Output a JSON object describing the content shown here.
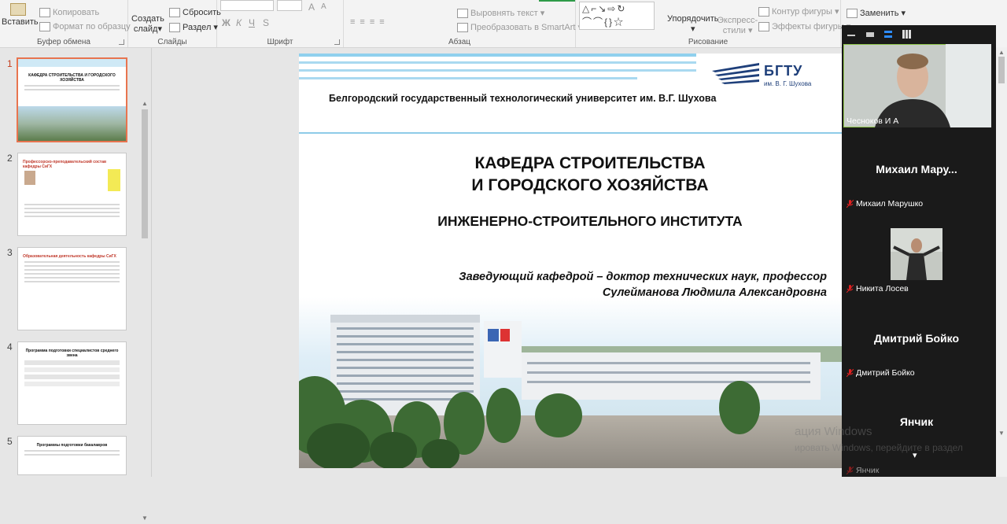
{
  "ribbon": {
    "paste_label": "Вставить",
    "copy_label": "Копировать",
    "format_painter_label": "Формат по образцу",
    "clipboard_group": "Буфер обмена",
    "new_slide_label": "Создать",
    "new_slide_label2": "слайд",
    "reset_label": "Сбросить",
    "section_label": "Раздел",
    "slides_group": "Слайды",
    "font_group": "Шрифт",
    "align_text_label": "Выровнять текст",
    "smartart_label": "Преобразовать в SmartArt",
    "paragraph_group": "Абзац",
    "arrange_label": "Упорядочить",
    "express_label": "Экспресс-",
    "styles_label": "стили",
    "shape_outline_label": "Контур фигуры",
    "shape_effects_label": "Эффекты фигуры",
    "drawing_group": "Рисование",
    "replace_label": "Заменить",
    "font_buttons": [
      "Ж",
      "К",
      "Ч",
      "S"
    ],
    "font_size_glyphs": [
      "A",
      "A"
    ]
  },
  "thumbnails": [
    {
      "number": "1",
      "title": "КАФЕДРА СТРОИТЕЛЬСТВА И ГОРОДСКОГО ХОЗЯЙСТВА",
      "selected": true
    },
    {
      "number": "2",
      "title": "Профессорско-преподавательский состав кафедры СиГХ",
      "selected": false
    },
    {
      "number": "3",
      "title": "Образовательная деятельность кафедры СиГХ",
      "selected": false
    },
    {
      "number": "4",
      "title": "Программа подготовки специалистов среднего звена",
      "selected": false
    },
    {
      "number": "5",
      "title": "Программы подготовки бакалавров",
      "selected": false
    }
  ],
  "slide": {
    "logo_brand": "БГТУ",
    "logo_sub": "им. В. Г. Шухова",
    "university": "Белгородский государственный технологический университет им. В.Г. Шухова",
    "title_line1": "КАФЕДРА СТРОИТЕЛЬСТВА",
    "title_line2": "И ГОРОДСКОГО ХОЗЯЙСТВА",
    "institute": "ИНЖЕНЕРНО-СТРОИТЕЛЬНОГО ИНСТИТУТА",
    "head_line1": "Заведующий  кафедрой – доктор технических наук,  профессор",
    "head_line2": "Сулейманова Людмила Александровна"
  },
  "video_panel": {
    "participants": [
      {
        "display": "",
        "label": "Чесноков И А",
        "muted": false,
        "video": true
      },
      {
        "display": "Михаил  Мару...",
        "label": "Михаил Марушко",
        "muted": true,
        "video": false
      },
      {
        "display": "",
        "label": "Никита Лосев",
        "muted": true,
        "video": true
      },
      {
        "display": "Дмитрий Бойко",
        "label": "Дмитрий Бойко",
        "muted": true,
        "video": false
      },
      {
        "display": "Янчик",
        "label": "Янчик",
        "muted": true,
        "video": false
      }
    ]
  },
  "watermark": {
    "line1": "ация Windows",
    "line2": "ировать Windows, перейдите в раздел"
  },
  "colors": {
    "ribbon_bg": "#f3f3f3",
    "selected_thumb_border": "#e8744f",
    "slide_stripe": "#a9d9f0",
    "logo_blue": "#1e3f7a",
    "video_bg": "#1a1a1a",
    "mute_red": "#e02020"
  }
}
